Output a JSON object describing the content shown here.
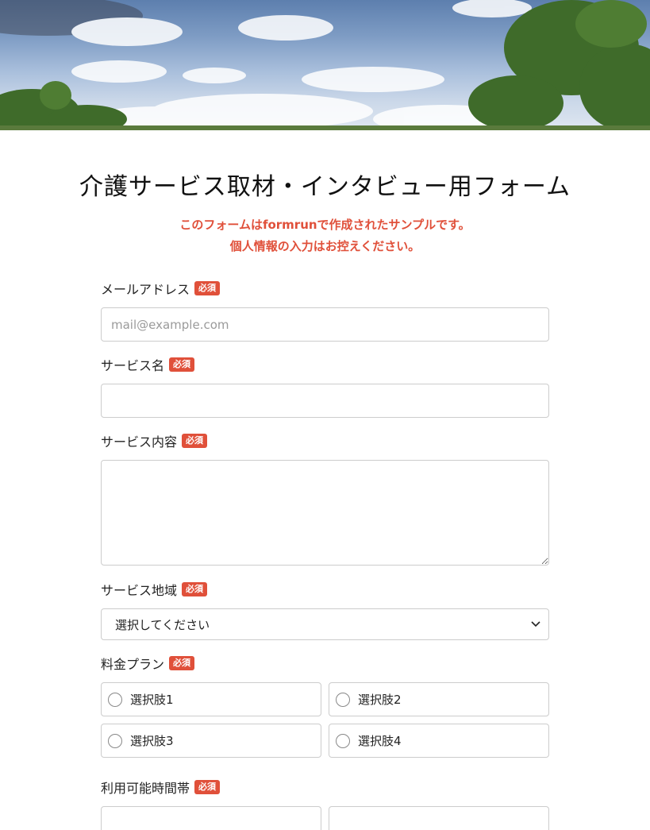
{
  "page": {
    "title": "介護サービス取材・インタビュー用フォーム",
    "notice_line1": "このフォームはformrunで作成されたサンプルです。",
    "notice_line2": "個人情報の入力はお控えください。",
    "accent_color": "#e0503a"
  },
  "fields": {
    "email": {
      "label": "メールアドレス",
      "required": "必須",
      "placeholder": "mail@example.com"
    },
    "service_name": {
      "label": "サービス名",
      "required": "必須"
    },
    "service_content": {
      "label": "サービス内容",
      "required": "必須"
    },
    "service_area": {
      "label": "サービス地域",
      "required": "必須",
      "selected": "選択してください"
    },
    "price_plan": {
      "label": "料金プラン",
      "required": "必須",
      "options": [
        "選択肢1",
        "選択肢2",
        "選択肢3",
        "選択肢4"
      ]
    },
    "available_time": {
      "label": "利用可能時間帯",
      "required": "必須"
    }
  },
  "icons": {
    "select_arrow": "chevron-down-icon",
    "radio": "radio-circle-icon"
  }
}
